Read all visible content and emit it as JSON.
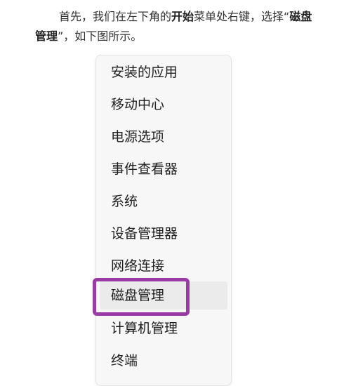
{
  "intro": {
    "part1": "首先，我们在左下角的",
    "bold1": "开始",
    "part2": "菜单处右键，选择“",
    "bold2": "磁盘管理",
    "part3": "”，如下图所示。"
  },
  "menu": {
    "items": [
      "安装的应用",
      "移动中心",
      "电源选项",
      "事件查看器",
      "系统",
      "设备管理器",
      "网络连接",
      "磁盘管理",
      "计算机管理",
      "终端"
    ],
    "highlighted_index": 7
  },
  "colors": {
    "highlight_border": "#9a3aa5",
    "menu_background": "#f7f7f7",
    "hover_background": "#ebebeb"
  }
}
